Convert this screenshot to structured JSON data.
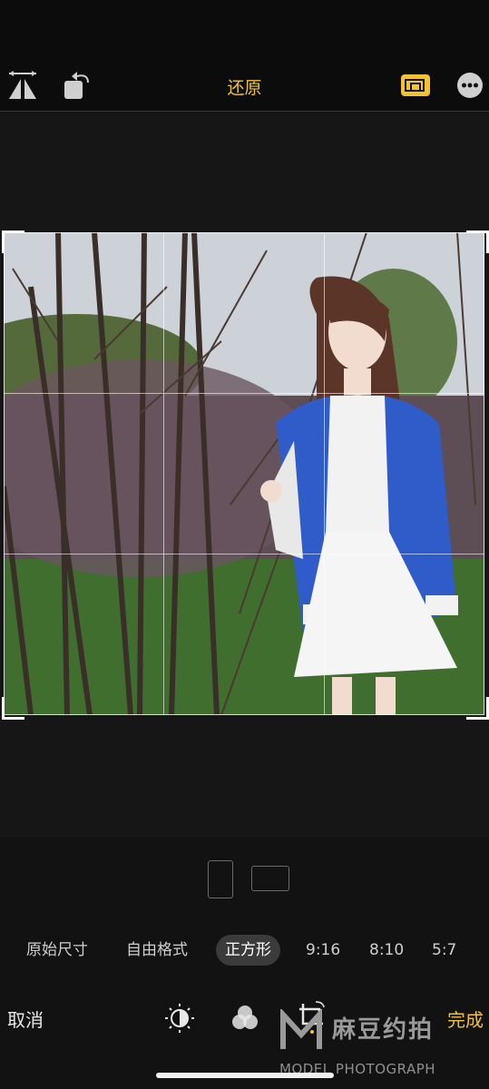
{
  "header": {
    "reset_label": "还原",
    "icons": [
      "flip-horizontal-icon",
      "rotate-icon",
      "aspect-ratio-icon",
      "more-icon"
    ]
  },
  "aspect_orientation": [
    "portrait-icon",
    "landscape-icon"
  ],
  "presets": [
    {
      "label": "原始尺寸",
      "active": false
    },
    {
      "label": "自由格式",
      "active": false
    },
    {
      "label": "正方形",
      "active": true
    },
    {
      "label": "9:16",
      "active": false
    },
    {
      "label": "8:10",
      "active": false
    },
    {
      "label": "5:7",
      "active": false
    }
  ],
  "footer": {
    "cancel_label": "取消",
    "done_label": "完成",
    "tool_icons": [
      "adjust-icon",
      "filters-icon",
      "crop-icon"
    ]
  },
  "watermark": {
    "main": "麻豆约拍",
    "sub": "MODEL PHOTOGRAPH"
  },
  "colors": {
    "accent": "#f2c230",
    "background": "#121212"
  }
}
